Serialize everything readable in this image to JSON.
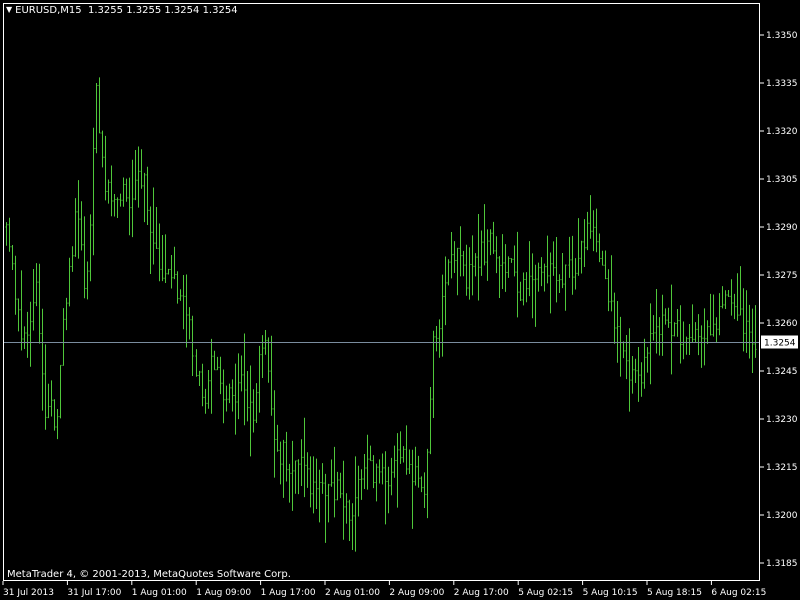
{
  "header": {
    "menu_glyph": "▼",
    "symbol": "EURUSD,M15",
    "ohlc": [
      "1.3255",
      "1.3255",
      "1.3254",
      "1.3254"
    ]
  },
  "copyright": "MetaTrader 4, © 2001-2013, MetaQuotes Software Corp.",
  "colors": {
    "background": "#000000",
    "foreground": "#ffffff",
    "bar": "#4fc73a",
    "bid_line": "#7a8c9e"
  },
  "chart_data": {
    "type": "bar",
    "subtype": "ohlc",
    "symbol": "EURUSD",
    "timeframe": "M15",
    "y_ticks": [
      "1.3350",
      "1.3335",
      "1.3320",
      "1.3305",
      "1.3290",
      "1.3275",
      "1.3260",
      "1.3245",
      "1.3230",
      "1.3215",
      "1.3200",
      "1.3185"
    ],
    "ylim": [
      1.318,
      1.3355
    ],
    "x_ticks": [
      "31 Jul 2013",
      "31 Jul 17:00",
      "1 Aug 01:00",
      "1 Aug 09:00",
      "1 Aug 17:00",
      "2 Aug 01:00",
      "2 Aug 09:00",
      "2 Aug 17:00",
      "5 Aug 02:15",
      "5 Aug 10:15",
      "5 Aug 18:15",
      "6 Aug 02:15"
    ],
    "bid_price": "1.3254",
    "grid": false,
    "closes": [
      1.329,
      1.3278,
      1.3268,
      1.3258,
      1.325,
      1.3262,
      1.3272,
      1.3252,
      1.3228,
      1.3238,
      1.3222,
      1.325,
      1.3265,
      1.3278,
      1.3294,
      1.3285,
      1.3265,
      1.3288,
      1.3335,
      1.3318,
      1.3305,
      1.3302,
      1.3298,
      1.3302,
      1.33,
      1.3296,
      1.3305,
      1.3308,
      1.3302,
      1.329,
      1.3285,
      1.3278,
      1.3275,
      1.3274,
      1.3272,
      1.327,
      1.3268,
      1.3258,
      1.3248,
      1.324,
      1.3236,
      1.3245,
      1.3248,
      1.3242,
      1.3238,
      1.3244,
      1.3236,
      1.324,
      1.3242,
      1.3232,
      1.3226,
      1.3252,
      1.3258,
      1.324,
      1.3226,
      1.3218,
      1.322,
      1.3214,
      1.3218,
      1.3218,
      1.3215,
      1.3211,
      1.3209,
      1.3208,
      1.3208,
      1.3209,
      1.3206,
      1.321,
      1.3204,
      1.32,
      1.3198,
      1.321,
      1.3213,
      1.3215,
      1.3214,
      1.3213,
      1.3211,
      1.3213,
      1.3219,
      1.322,
      1.3218,
      1.3217,
      1.3214,
      1.321,
      1.3205,
      1.3222,
      1.3252,
      1.3258,
      1.327,
      1.3282,
      1.3285,
      1.328,
      1.3275,
      1.3272,
      1.3278,
      1.328,
      1.3282,
      1.3284,
      1.3285,
      1.3282,
      1.328,
      1.3278,
      1.3276,
      1.3274,
      1.327,
      1.3272,
      1.3272,
      1.3274,
      1.3276,
      1.3276,
      1.3277,
      1.3277,
      1.3276,
      1.3275,
      1.3278,
      1.3279,
      1.3282,
      1.3294,
      1.329,
      1.3285,
      1.328,
      1.327,
      1.3264,
      1.3256,
      1.325,
      1.3245,
      1.3243,
      1.3242,
      1.3245,
      1.3252,
      1.3256,
      1.3259,
      1.326,
      1.3258,
      1.3256,
      1.3258,
      1.3257,
      1.3255,
      1.3256,
      1.3257,
      1.3257,
      1.3258,
      1.3257,
      1.326,
      1.3265,
      1.3266,
      1.3265,
      1.3264,
      1.3262,
      1.3258,
      1.3255,
      1.3254
    ]
  }
}
